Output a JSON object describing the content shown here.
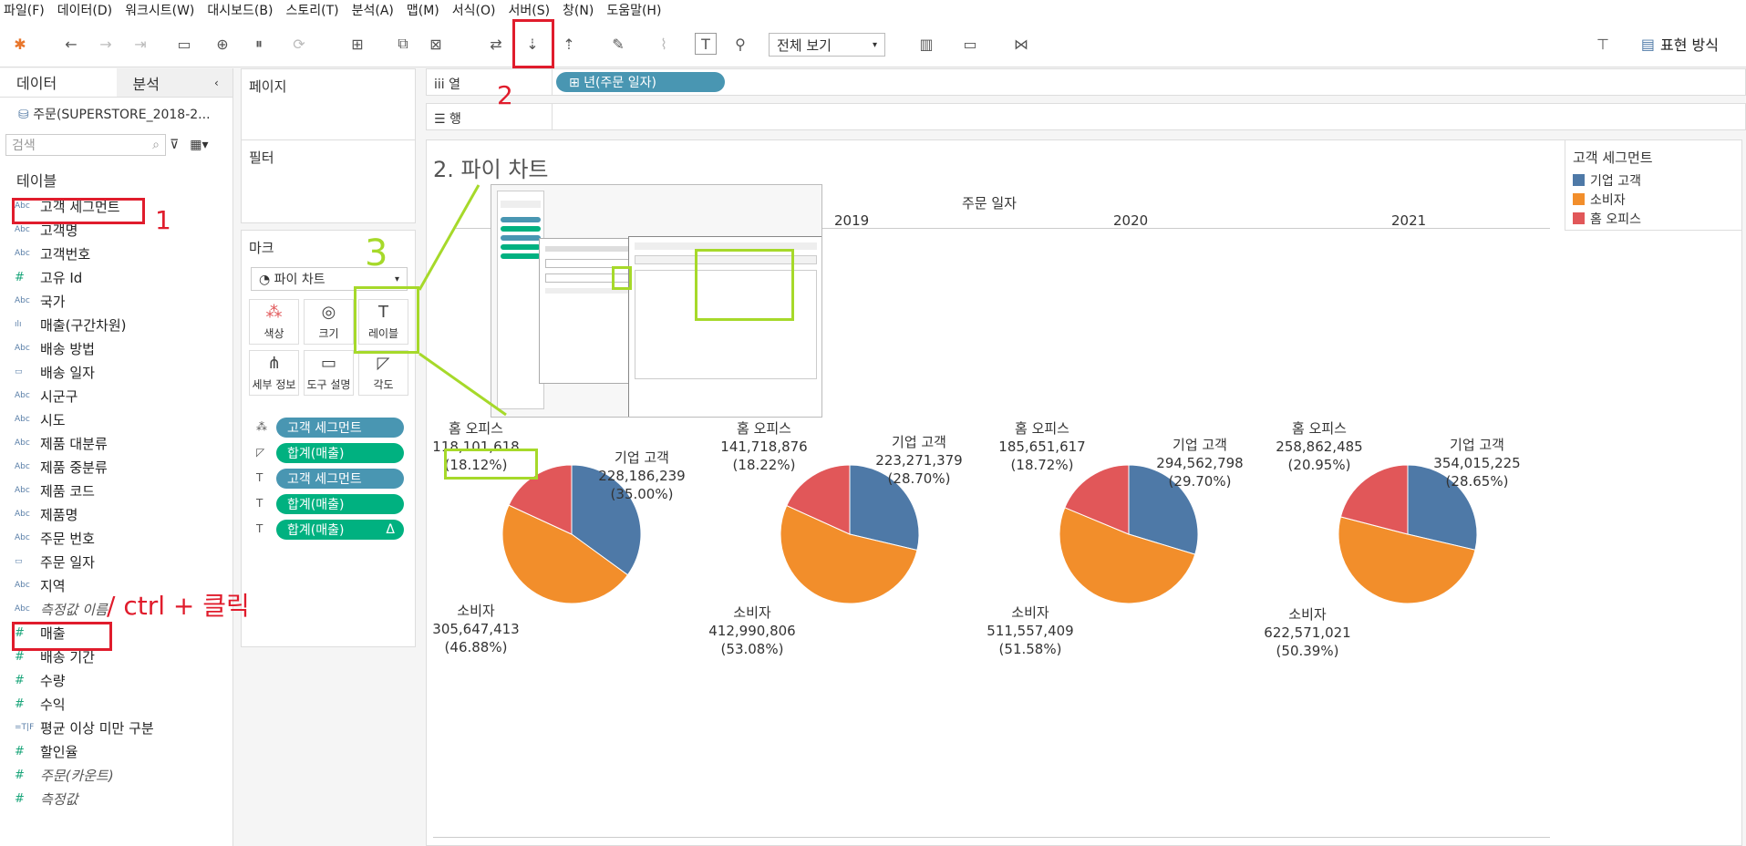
{
  "menu": [
    "파일(F)",
    "데이터(D)",
    "워크시트(W)",
    "대시보드(B)",
    "스토리(T)",
    "분석(A)",
    "맵(M)",
    "서식(O)",
    "서버(S)",
    "창(N)",
    "도움말(H)"
  ],
  "toolbar": {
    "view_select": "전체 보기",
    "show_me": "표현 방식"
  },
  "data_pane": {
    "tabs": [
      "데이터",
      "분석"
    ],
    "datasource": "주문(SUPERSTORE_2018-2...",
    "search_placeholder": "검색",
    "section": "테이블",
    "fields": [
      {
        "type": "Abc",
        "name": "고객 세그먼트"
      },
      {
        "type": "Abc",
        "name": "고객명"
      },
      {
        "type": "Abc",
        "name": "고객번호"
      },
      {
        "type": "#",
        "name": "고유 Id"
      },
      {
        "type": "Abc",
        "name": "국가"
      },
      {
        "type": "ılı",
        "name": "매출(구간차원)"
      },
      {
        "type": "Abc",
        "name": "배송 방법"
      },
      {
        "type": "▭",
        "name": "배송 일자"
      },
      {
        "type": "Abc",
        "name": "시군구"
      },
      {
        "type": "Abc",
        "name": "시도"
      },
      {
        "type": "Abc",
        "name": "제품 대분류"
      },
      {
        "type": "Abc",
        "name": "제품 중분류"
      },
      {
        "type": "Abc",
        "name": "제품 코드"
      },
      {
        "type": "Abc",
        "name": "제품명"
      },
      {
        "type": "Abc",
        "name": "주문 번호"
      },
      {
        "type": "▭",
        "name": "주문 일자"
      },
      {
        "type": "Abc",
        "name": "지역"
      },
      {
        "type": "Abc",
        "name": "측정값 이름"
      },
      {
        "type": "#",
        "name": "매출"
      },
      {
        "type": "#",
        "name": "배송 기간"
      },
      {
        "type": "#",
        "name": "수량"
      },
      {
        "type": "#",
        "name": "수익"
      },
      {
        "type": "=T|F",
        "name": "평균 이상 미만 구분"
      },
      {
        "type": "#",
        "name": "할인율"
      },
      {
        "type": "#",
        "name": "주문(카운트)"
      },
      {
        "type": "#",
        "name": "측정값"
      }
    ]
  },
  "cards": {
    "pages": "페이지",
    "filters": "필터",
    "marks": "마크",
    "mark_type": "파이 차트",
    "buttons": [
      "색상",
      "크기",
      "레이블",
      "세부 정보",
      "도구 설명",
      "각도"
    ],
    "pills": [
      {
        "icon": "color",
        "label": "고객 세그먼트",
        "kind": "blue"
      },
      {
        "icon": "angle",
        "label": "합계(매출)",
        "kind": "green"
      },
      {
        "icon": "text",
        "label": "고객 세그먼트",
        "kind": "blue"
      },
      {
        "icon": "text",
        "label": "합계(매출)",
        "kind": "green"
      },
      {
        "icon": "text",
        "label": "합계(매출)",
        "kind": "green",
        "delta": "Δ"
      }
    ]
  },
  "shelves": {
    "columns_label": "열",
    "rows_label": "행",
    "column_pill": "⊞ 년(주문 일자)"
  },
  "view": {
    "title": "2. 파이 차트",
    "header": "주문 일자",
    "years": [
      "2019",
      "2020",
      "2021"
    ]
  },
  "legend": {
    "title": "고객 세그먼트",
    "items": [
      {
        "label": "기업 고객",
        "color": "#4e79a7"
      },
      {
        "label": "소비자",
        "color": "#f28e2b"
      },
      {
        "label": "홈 오피스",
        "color": "#e15759"
      }
    ]
  },
  "chart_data": {
    "type": "pie",
    "categories": [
      "기업 고객",
      "소비자",
      "홈 오피스"
    ],
    "series": [
      {
        "values": [
          228186239,
          305647413,
          118101618
        ],
        "labels": [
          "228,186,239",
          "305,647,413",
          "118,101,618"
        ],
        "pct": [
          "(35.00%)",
          "(46.88%)",
          "(18.12%)"
        ]
      },
      {
        "values": [
          223271379,
          412990806,
          141718876
        ],
        "labels": [
          "223,271,379",
          "412,990,806",
          "141,718,876"
        ],
        "pct": [
          "(28.70%)",
          "(53.08%)",
          "(18.22%)"
        ]
      },
      {
        "values": [
          294562798,
          511557409,
          185651617
        ],
        "labels": [
          "294,562,798",
          "511,557,409",
          "185,651,617"
        ],
        "pct": [
          "(29.70%)",
          "(51.58%)",
          "(18.72%)"
        ]
      },
      {
        "values": [
          354015225,
          622571021,
          258862485
        ],
        "labels": [
          "354,015,225",
          "622,571,021",
          "258,862,485"
        ],
        "pct": [
          "(28.65%)",
          "(50.39%)",
          "(20.95%)"
        ]
      }
    ]
  },
  "annotations": {
    "one": "1",
    "two": "2",
    "three": "3",
    "ctrl": "/ ctrl + 클릭"
  }
}
